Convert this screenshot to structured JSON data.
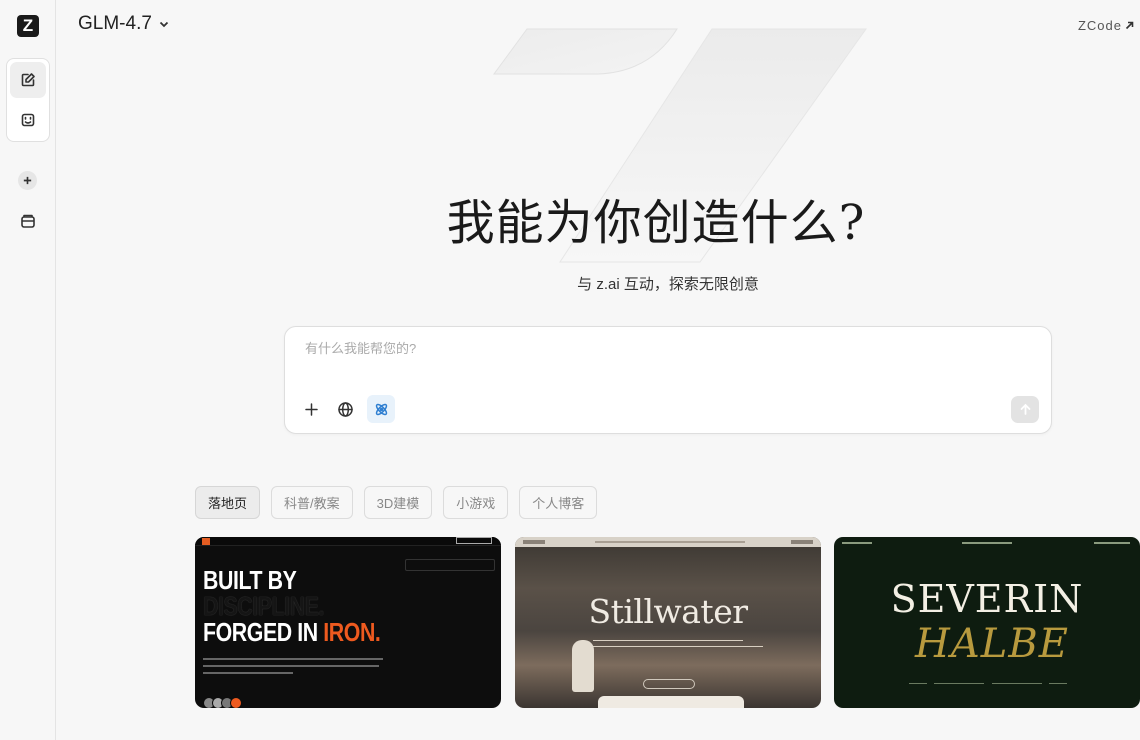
{
  "logo": {
    "letter": "Z"
  },
  "header": {
    "model_name": "GLM-4.7",
    "zcode_label": "ZCode"
  },
  "hero": {
    "title": "我能为你创造什么?",
    "subtitle": "与 z.ai 互动，探索无限创意"
  },
  "composer": {
    "placeholder": "有什么我能帮您的?",
    "value": ""
  },
  "categories": [
    {
      "label": "落地页",
      "active": true
    },
    {
      "label": "科普/教案",
      "active": false
    },
    {
      "label": "3D建模",
      "active": false
    },
    {
      "label": "小游戏",
      "active": false
    },
    {
      "label": "个人博客",
      "active": false
    }
  ],
  "cards": [
    {
      "line1": "BUILT BY",
      "line2": "DISCIPLINE.",
      "line3a": "FORGED IN ",
      "line3b": "IRON."
    },
    {
      "title": "Stillwater"
    },
    {
      "name1": "SEVERIN",
      "name2": "HALBE"
    }
  ],
  "colors": {
    "accent_blue": "#2f7fd1",
    "card1_accent": "#ee5a1f",
    "card3_gold": "#b89a3e",
    "card3_bg": "#0e1c10"
  }
}
